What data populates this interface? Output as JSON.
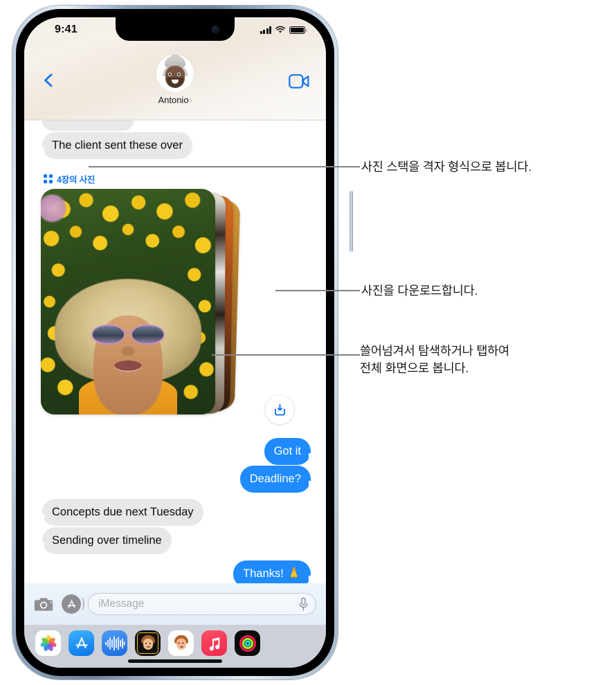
{
  "device": {
    "name": "iPhone",
    "status_bar": {
      "time": "9:41",
      "cellular_icon": "signal-bars-icon",
      "wifi_icon": "wifi-icon",
      "battery_icon": "battery-full-icon"
    },
    "home_indicator": "home-indicator"
  },
  "nav": {
    "back_icon": "back-chevron-icon",
    "contact_name": "Antonio",
    "contact_chevron": "›",
    "facetime_icon": "video-camera-icon"
  },
  "thread": {
    "photo_stack": {
      "grid_icon": "grid-2x2-icon",
      "count_label": "4장의 사진",
      "accent_color": "#1676ee",
      "download_icon": "download-tray-icon",
      "photo_count": 4
    },
    "messages": [
      {
        "id": "m0",
        "sender": "them",
        "text": "",
        "partial": true
      },
      {
        "id": "m1",
        "sender": "them",
        "text": "The client sent these over"
      },
      {
        "id": "m2",
        "sender": "me",
        "text": "Got it"
      },
      {
        "id": "m3",
        "sender": "me",
        "text": "Deadline?"
      },
      {
        "id": "m4",
        "sender": "them",
        "text": "Concepts due next Tuesday"
      },
      {
        "id": "m5",
        "sender": "them",
        "text": "Sending over timeline"
      },
      {
        "id": "m6",
        "sender": "me",
        "text": "Thanks! 🙏"
      }
    ],
    "bubble_colors": {
      "me": "#1f8bff",
      "them": "#e8e8ea"
    }
  },
  "input_bar": {
    "camera_icon": "camera-icon",
    "appstore_icon": "app-store-icon",
    "placeholder": "iMessage",
    "value": "",
    "mic_icon": "microphone-icon"
  },
  "app_drawer": {
    "apps": [
      {
        "name": "photos-app",
        "label": "Photos"
      },
      {
        "name": "app-store-app",
        "label": "App Store"
      },
      {
        "name": "audio-message-app",
        "label": "Audio"
      },
      {
        "name": "memoji-app",
        "label": "Memoji"
      },
      {
        "name": "stickers-app",
        "label": "Stickers"
      },
      {
        "name": "music-app",
        "label": "Music"
      },
      {
        "name": "fitness-app",
        "label": "Fitness"
      }
    ]
  },
  "callouts": [
    {
      "id": "c1",
      "text": "사진 스택을 격자 형식으로 봅니다.",
      "target": "photo-stack-grid-toggle"
    },
    {
      "id": "c2",
      "text": "사진을 다운로드합니다.",
      "target": "photo-download-button"
    },
    {
      "id": "c3",
      "line1": "쓸어넘겨서 탐색하거나 탭하여",
      "line2": "전체 화면으로 봅니다.",
      "target": "photo-stack"
    }
  ]
}
